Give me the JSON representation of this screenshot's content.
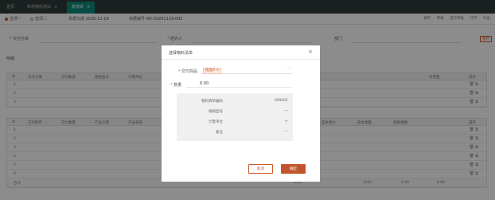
{
  "tabs": [
    {
      "label": "首页"
    },
    {
      "label": "新增物料借出",
      "close": "×"
    },
    {
      "label": "新增单",
      "close": "×"
    }
  ],
  "toolbar": {
    "radio1": "选项一",
    "radio2": "选项二",
    "date_label": "单据日期",
    "date_value": "2020-11-19",
    "doc_label": "单据编号",
    "doc_value": "AD-20201119-001",
    "actions": [
      "保存",
      "审核",
      "提交审批",
      "打印",
      "导出"
    ]
  },
  "form": {
    "f1_label": "交付仓库",
    "f2_label": "经办人",
    "f3_label": "部门",
    "save": "保存"
  },
  "section_title": "明细",
  "grid1": {
    "headers": [
      "交付仓库",
      "交付数量",
      "规格型号",
      "计量单位",
      "可用量",
      "操作"
    ],
    "rows": [
      "1",
      "2",
      "3"
    ]
  },
  "grid2": {
    "headers": [
      "交付库存",
      "交付数量",
      "产品仓库",
      "产品名称",
      "成本单价",
      "成本金额",
      "调拨金额",
      "操作"
    ],
    "rows": [
      "1",
      "2",
      "3",
      "4",
      "5",
      "6"
    ]
  },
  "totals": [
    "合计",
    "0.00",
    "0.00",
    "0.00",
    "0.00"
  ],
  "modal": {
    "title": "选择物料清单",
    "close": "×",
    "goods_label": "交付商品",
    "goods_chip": "成品A ×",
    "goods_more": "···",
    "qty_label": "数量",
    "qty_value": "6.00",
    "details": [
      {
        "label": "物料清单编码",
        "value": "000001"
      },
      {
        "label": "规格型号",
        "value": "—"
      },
      {
        "label": "计量单位",
        "value": "个"
      },
      {
        "label": "备注",
        "value": "—"
      }
    ],
    "cancel": "取消",
    "ok": "确定"
  },
  "colors": {
    "accent": "#c1552b",
    "tab_active": "#0f8a7a",
    "tabbar": "#2f3b3a"
  }
}
